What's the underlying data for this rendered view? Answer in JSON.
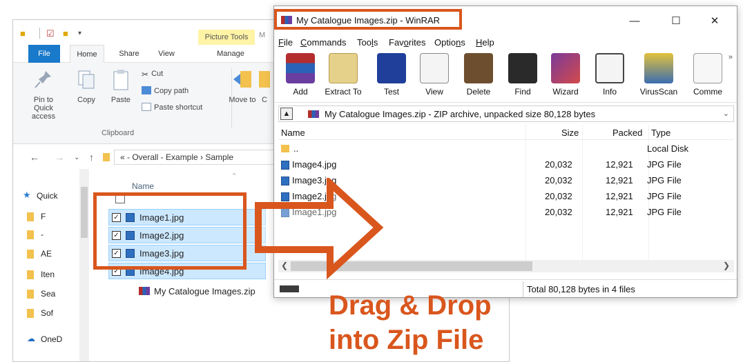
{
  "explorer": {
    "contextual_tab": "Picture Tools",
    "contextual_tab_cut": "M",
    "tabs": [
      "File",
      "Home",
      "Share",
      "View",
      "Manage"
    ],
    "ribbon": {
      "pin_label": "Pin to Quick access",
      "copy_label": "Copy",
      "paste_label": "Paste",
      "cut_label": "Cut",
      "copy_path_label": "Copy path",
      "paste_shortcut_label": "Paste shortcut",
      "move_to_label": "Move to",
      "copy_to_cut": "C",
      "group_label": "Clipboard"
    },
    "address": "« - Overall - Example › Sample",
    "nav_items": [
      "Quick",
      "F",
      "-",
      "AE",
      "Iten",
      "Sea",
      "Sof",
      "OneD"
    ],
    "column_name": "Name",
    "files": [
      "Image1.jpg",
      "Image2.jpg",
      "Image3.jpg",
      "Image4.jpg"
    ],
    "zip_file": "My Catalogue Images.zip"
  },
  "winrar": {
    "title": "My Catalogue Images.zip - WinRAR",
    "menu": [
      {
        "pre": "",
        "ul": "F",
        "post": "ile"
      },
      {
        "pre": "",
        "ul": "C",
        "post": "ommands"
      },
      {
        "pre": "Too",
        "ul": "l",
        "post": "s"
      },
      {
        "pre": "Fav",
        "ul": "o",
        "post": "rites"
      },
      {
        "pre": "Optio",
        "ul": "n",
        "post": "s"
      },
      {
        "pre": "",
        "ul": "H",
        "post": "elp"
      }
    ],
    "toolbar": [
      "Add",
      "Extract To",
      "Test",
      "View",
      "Delete",
      "Find",
      "Wizard",
      "Info",
      "VirusScan",
      "Comme"
    ],
    "path_text": "My Catalogue Images.zip - ZIP archive, unpacked size 80,128 bytes",
    "columns": {
      "name": "Name",
      "size": "Size",
      "packed": "Packed",
      "type": "Type"
    },
    "rows": [
      {
        "name": "..",
        "size": "",
        "packed": "",
        "type": "Local Disk"
      },
      {
        "name": "Image4.jpg",
        "size": "20,032",
        "packed": "12,921",
        "type": "JPG File"
      },
      {
        "name": "Image3.jpg",
        "size": "20,032",
        "packed": "12,921",
        "type": "JPG File"
      },
      {
        "name": "Image2.jpg",
        "size": "20,032",
        "packed": "12,921",
        "type": "JPG File"
      },
      {
        "name": "Image1.jpg",
        "size": "20,032",
        "packed": "12,921",
        "type": "JPG File"
      }
    ],
    "status": "Total 80,128 bytes in 4 files"
  },
  "annotation": {
    "line1": "Drag & Drop",
    "line2": "into Zip File",
    "color": "#d9561d"
  }
}
